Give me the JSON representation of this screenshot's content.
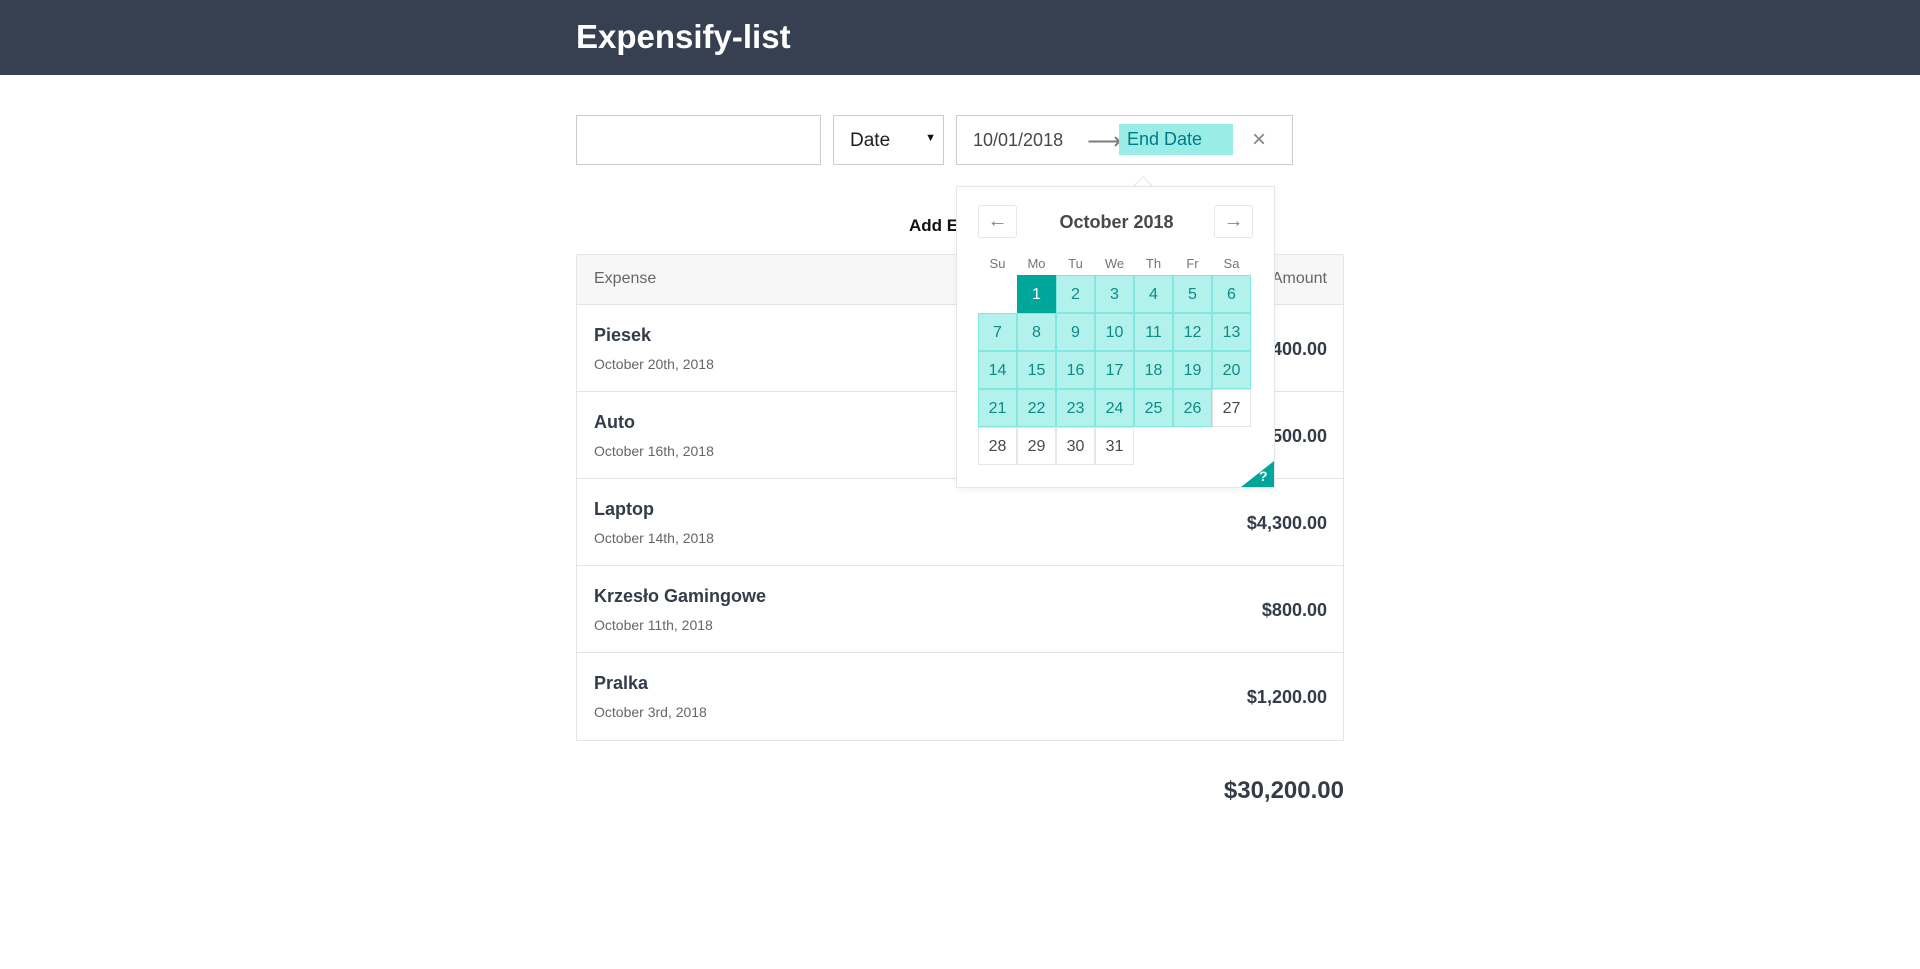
{
  "app": {
    "title": "Expensify-list"
  },
  "filters": {
    "text_value": "",
    "sort_by": "Date",
    "start_date": "10/01/2018",
    "end_date_placeholder": "End Date",
    "arrow": "⟶",
    "clear": "×"
  },
  "add_expense_label": "Add E",
  "list": {
    "header_left": "Expense",
    "header_right": "Amount",
    "rows": [
      {
        "description": "Piesek",
        "date": "October 20th, 2018",
        "amount": "400.00"
      },
      {
        "description": "Auto",
        "date": "October 16th, 2018",
        "amount": "500.00"
      },
      {
        "description": "Laptop",
        "date": "October 14th, 2018",
        "amount": "$4,300.00"
      },
      {
        "description": "Krzesło Gamingowe",
        "date": "October 11th, 2018",
        "amount": "$800.00"
      },
      {
        "description": "Pralka",
        "date": "October 3rd, 2018",
        "amount": "$1,200.00"
      }
    ]
  },
  "total": "$30,200.00",
  "calendar": {
    "month_label": "October 2018",
    "prev_icon": "←",
    "next_icon": "→",
    "weekdays": [
      "Su",
      "Mo",
      "Tu",
      "We",
      "Th",
      "Fr",
      "Sa"
    ],
    "days": [
      "1",
      "2",
      "3",
      "4",
      "5",
      "6",
      "7",
      "8",
      "9",
      "10",
      "11",
      "12",
      "13",
      "14",
      "15",
      "16",
      "17",
      "18",
      "19",
      "20",
      "21",
      "22",
      "23",
      "24",
      "25",
      "26",
      "27",
      "28",
      "29",
      "30",
      "31"
    ],
    "help_label": "?"
  },
  "colors": {
    "header": "#364051",
    "accent": "#00a699",
    "range_highlight": "#b2f1ec"
  }
}
